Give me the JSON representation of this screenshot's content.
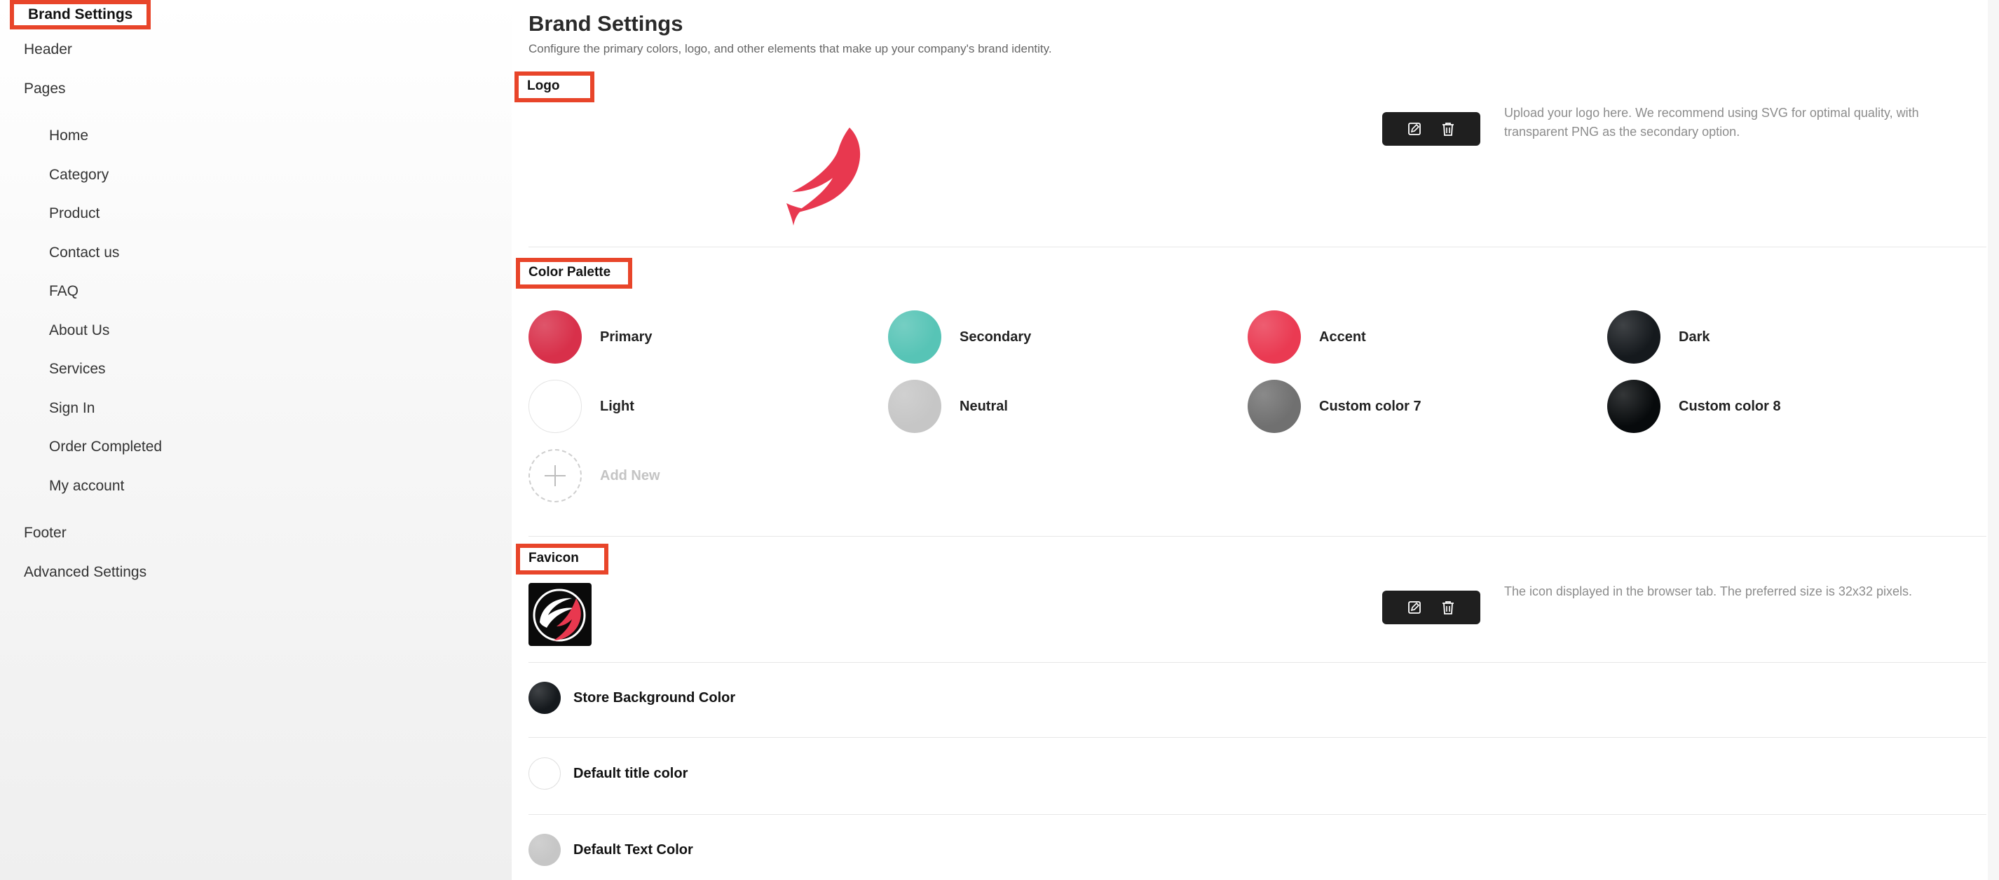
{
  "sidebar": {
    "active": "Brand Settings",
    "items": [
      {
        "label": "Header"
      },
      {
        "label": "Pages"
      }
    ],
    "pages": [
      {
        "label": "Home"
      },
      {
        "label": "Category"
      },
      {
        "label": "Product"
      },
      {
        "label": "Contact us"
      },
      {
        "label": "FAQ"
      },
      {
        "label": "About Us"
      },
      {
        "label": "Services"
      },
      {
        "label": "Sign In"
      },
      {
        "label": "Order Completed"
      },
      {
        "label": "My account"
      }
    ],
    "bottom_items": [
      {
        "label": "Footer"
      },
      {
        "label": "Advanced Settings"
      }
    ]
  },
  "main": {
    "title": "Brand Settings",
    "subtitle": "Configure the primary colors, logo, and other elements that make up your company's brand identity.",
    "logo": {
      "label": "Logo",
      "help": "Upload your logo here. We recommend using SVG for optimal quality, with transparent PNG as the secondary option.",
      "logo_color": "#e8384f"
    },
    "palette": {
      "label": "Color Palette",
      "colors": [
        {
          "name": "Primary",
          "color": "#d8304a"
        },
        {
          "name": "Secondary",
          "color": "#57c4b6"
        },
        {
          "name": "Accent",
          "color": "#ea3a52"
        },
        {
          "name": "Dark",
          "color": "#15191d"
        },
        {
          "name": "Light",
          "color": "#ffffff"
        },
        {
          "name": "Neutral",
          "color": "#c6c6c6"
        },
        {
          "name": "Custom color 7",
          "color": "#707070"
        },
        {
          "name": "Custom color 8",
          "color": "#070a0c"
        }
      ],
      "add_new": "Add New"
    },
    "favicon": {
      "label": "Favicon",
      "help": "The icon displayed in the browser tab. The preferred size is 32x32 pixels."
    },
    "color_settings": [
      {
        "label": "Store Background Color",
        "color": "#15191d"
      },
      {
        "label": "Default title color",
        "color": "#ffffff"
      },
      {
        "label": "Default Text Color",
        "color": "#c6c6c6"
      }
    ]
  }
}
